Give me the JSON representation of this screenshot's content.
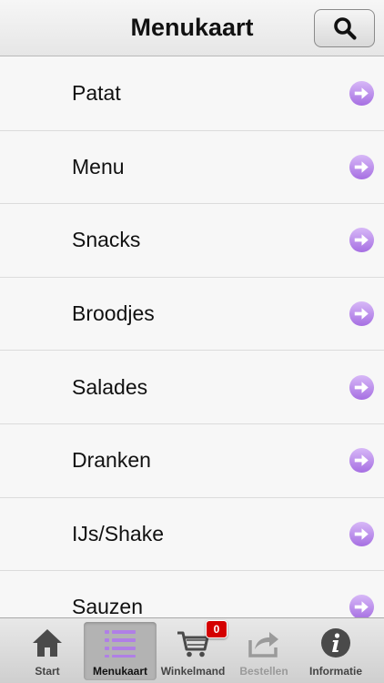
{
  "header": {
    "title": "Menukaart",
    "search_icon": "search-icon"
  },
  "menu": {
    "items": [
      {
        "label": "Patat"
      },
      {
        "label": "Menu"
      },
      {
        "label": "Snacks"
      },
      {
        "label": "Broodjes"
      },
      {
        "label": "Salades"
      },
      {
        "label": "Dranken"
      },
      {
        "label": "IJs/Shake"
      },
      {
        "label": "Sauzen"
      }
    ],
    "arrow_icon": "arrow-right-circle-icon",
    "arrow_color": "#b98ee8"
  },
  "tabbar": {
    "tabs": [
      {
        "label": "Start",
        "icon": "home-icon"
      },
      {
        "label": "Menukaart",
        "icon": "list-icon"
      },
      {
        "label": "Winkelmand",
        "icon": "cart-icon"
      },
      {
        "label": "Bestellen",
        "icon": "share-icon"
      },
      {
        "label": "Informatie",
        "icon": "info-icon"
      }
    ],
    "active_tab": "Menukaart",
    "cart_count": "0",
    "badge_color": "#d40000",
    "active_icon_color": "#b07fe6"
  }
}
